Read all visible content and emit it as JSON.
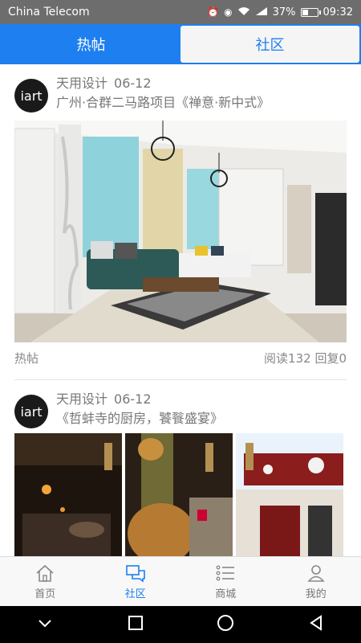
{
  "status_bar": {
    "carrier": "China Telecom",
    "icons": [
      "alarm-icon",
      "eye-icon",
      "wifi-icon",
      "signal-4g-icon"
    ],
    "battery_percent_label": "37%",
    "battery_level": 0.37,
    "time": "09:32"
  },
  "tabs": [
    {
      "label": "热帖",
      "active": true
    },
    {
      "label": "社区",
      "active": false
    }
  ],
  "posts": [
    {
      "avatar_text": "iart",
      "author": "天用设计",
      "date": "06-12",
      "title": "广州·合群二马路项目《禅意·新中式》",
      "category": "热帖",
      "stats": "阅读132 回复0"
    },
    {
      "avatar_text": "iart",
      "author": "天用设计",
      "date": "06-12",
      "title": "《哲蚌寺的厨房，饕餮盛宴》"
    }
  ],
  "bottom_nav": [
    {
      "label": "首页",
      "icon": "home-icon",
      "active": false
    },
    {
      "label": "社区",
      "icon": "chat-bubbles-icon",
      "active": true
    },
    {
      "label": "商城",
      "icon": "list-icon",
      "active": false
    },
    {
      "label": "我的",
      "icon": "user-icon",
      "active": false
    }
  ],
  "colors": {
    "accent": "#1e7ff0",
    "status_bar": "#6d6d6d"
  }
}
